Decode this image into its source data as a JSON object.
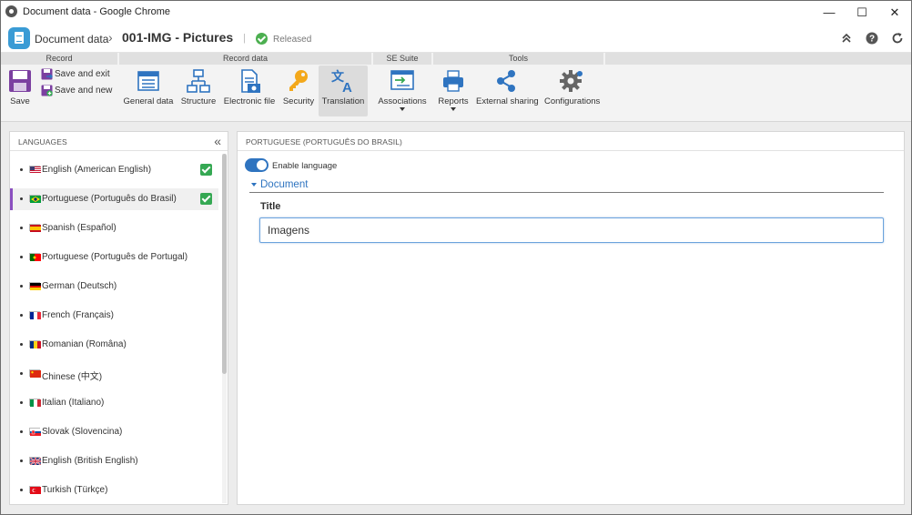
{
  "window": {
    "title": "Document data - Google Chrome",
    "minimize": "—",
    "maximize": "☐",
    "close": "✕"
  },
  "header": {
    "breadcrumb_root": "Document data",
    "separator": "›",
    "record_title": "001-IMG - Pictures",
    "divider": "|",
    "status": "Released"
  },
  "ribbon": {
    "groups": {
      "record": "Record",
      "record_data": "Record data",
      "se_suite": "SE Suite",
      "tools": "Tools"
    },
    "save": "Save",
    "save_and_exit": "Save and exit",
    "save_and_new": "Save and new",
    "general_data": "General data",
    "structure": "Structure",
    "electronic_file": "Electronic file",
    "security": "Security",
    "translation": "Translation",
    "associations": "Associations",
    "reports": "Reports",
    "external_sharing": "External sharing",
    "configurations": "Configurations"
  },
  "languages_panel": {
    "title": "LANGUAGES",
    "items": [
      {
        "label": "English (American English)",
        "flag": "us",
        "enabled": true,
        "selected": false
      },
      {
        "label": "Portuguese (Português do Brasil)",
        "flag": "br",
        "enabled": true,
        "selected": true
      },
      {
        "label": "Spanish (Español)",
        "flag": "es",
        "enabled": false,
        "selected": false
      },
      {
        "label": "Portuguese (Português de Portugal)",
        "flag": "pt",
        "enabled": false,
        "selected": false
      },
      {
        "label": "German (Deutsch)",
        "flag": "de",
        "enabled": false,
        "selected": false
      },
      {
        "label": "French (Français)",
        "flag": "fr",
        "enabled": false,
        "selected": false
      },
      {
        "label": "Romanian (Româna)",
        "flag": "ro",
        "enabled": false,
        "selected": false
      },
      {
        "label": "Chinese (中文)",
        "flag": "cn",
        "enabled": false,
        "selected": false
      },
      {
        "label": "Italian (Italiano)",
        "flag": "it",
        "enabled": false,
        "selected": false
      },
      {
        "label": "Slovak (Slovencina)",
        "flag": "sk",
        "enabled": false,
        "selected": false
      },
      {
        "label": "English (British English)",
        "flag": "gb",
        "enabled": false,
        "selected": false
      },
      {
        "label": "Turkish (Türkçe)",
        "flag": "tr",
        "enabled": false,
        "selected": false
      }
    ]
  },
  "detail_panel": {
    "title": "PORTUGUESE (PORTUGUÊS DO BRASIL)",
    "enable_language_label": "Enable language",
    "enable_language_on": true,
    "section_title": "Document",
    "field_label": "Title",
    "field_value": "Imagens"
  },
  "colors": {
    "accent": "#2f74c0",
    "selected_marker": "#8a4fbf",
    "check": "#35a853",
    "status": "#4caf50"
  }
}
